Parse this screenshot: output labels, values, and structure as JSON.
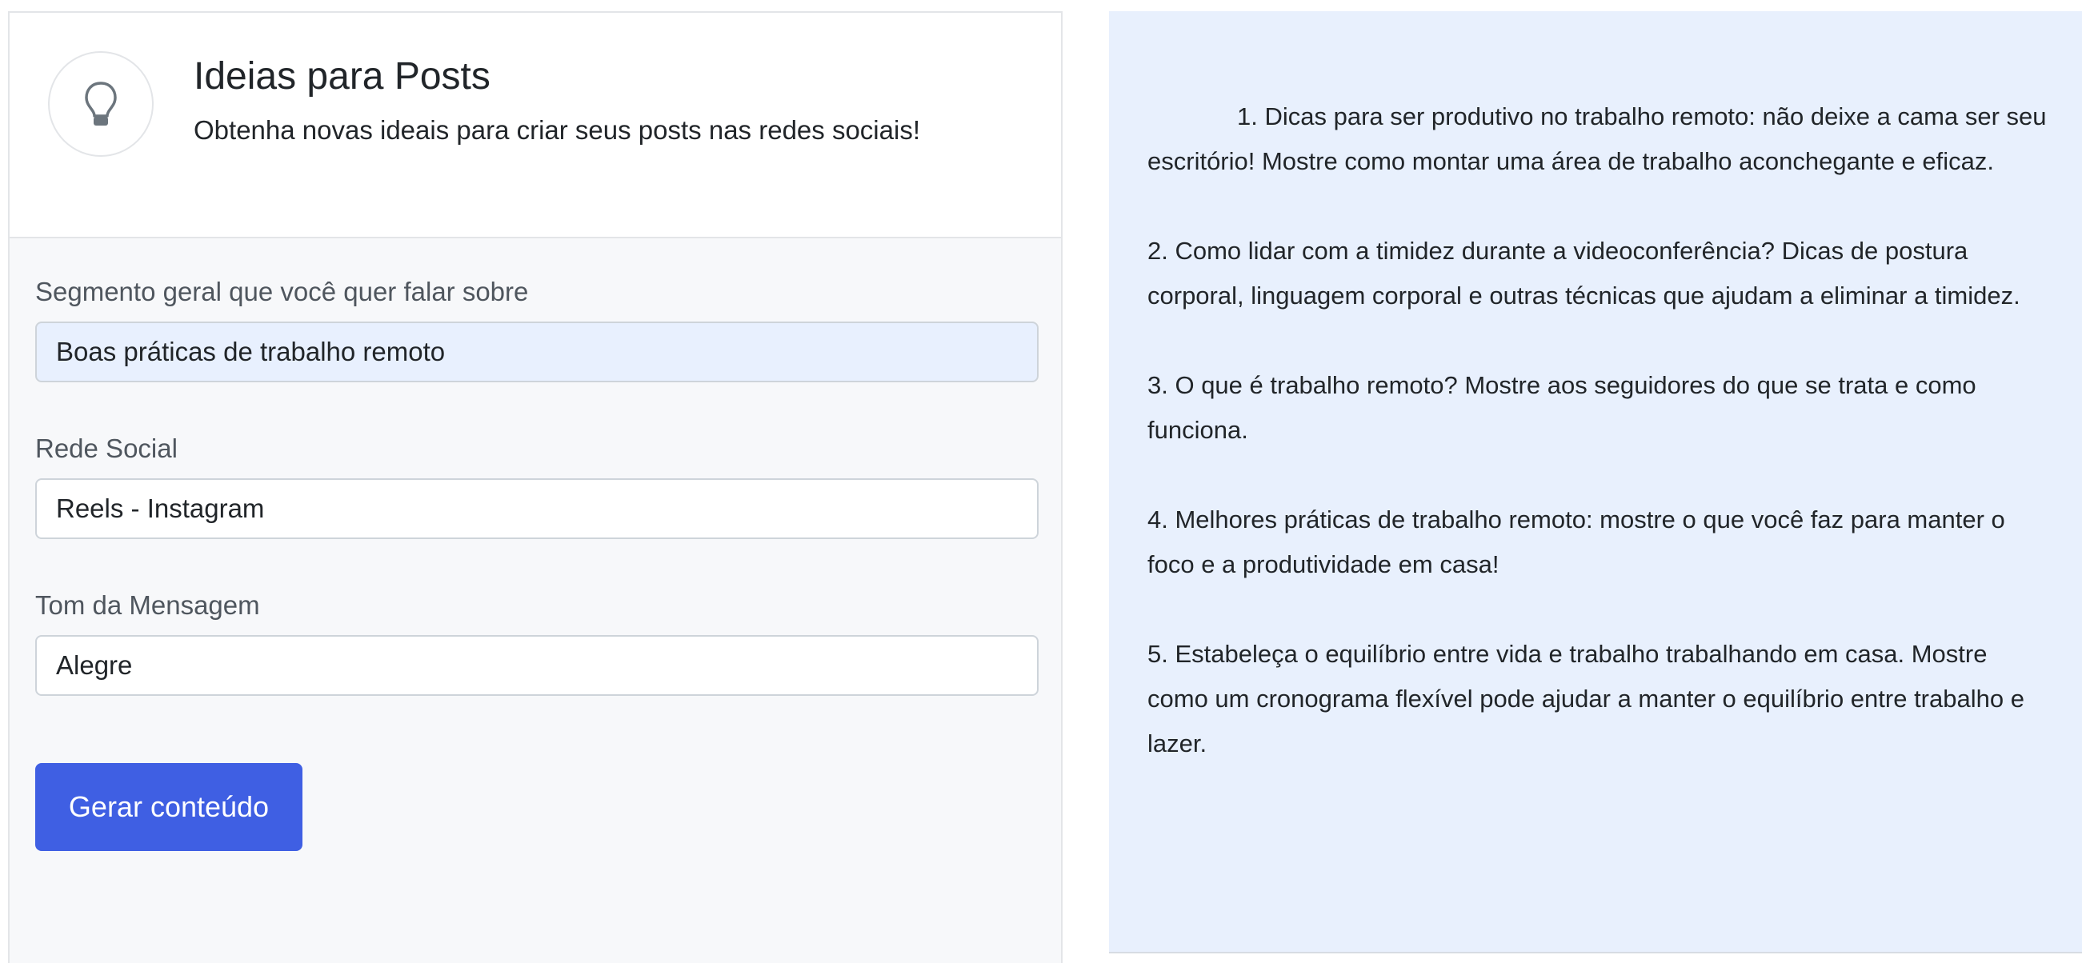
{
  "header": {
    "title": "Ideias para Posts",
    "subtitle": "Obtenha novas ideais para criar seus posts nas redes sociais!",
    "icon": "lightbulb-icon"
  },
  "form": {
    "segment": {
      "label": "Segmento geral que você quer falar sobre",
      "value": "Boas práticas de trabalho remoto"
    },
    "social": {
      "label": "Rede Social",
      "value": "Reels - Instagram"
    },
    "tone": {
      "label": "Tom da Mensagem",
      "value": "Alegre"
    },
    "submit_label": "Gerar conteúdo"
  },
  "output": {
    "ideas": [
      "1. Dicas para ser produtivo no trabalho remoto: não deixe a cama ser seu escritório! Mostre como montar uma área de trabalho aconchegante e eficaz.",
      "2. Como lidar com a timidez durante a videoconferência? Dicas de postura corporal, linguagem corporal e outras técnicas que ajudam a eliminar a timidez.",
      "3. O que é trabalho remoto? Mostre aos seguidores do que se trata e como funciona.",
      "4. Melhores práticas de trabalho remoto: mostre o que você faz para manter o foco e a produtividade em casa!",
      "5. Estabeleça o equilíbrio entre vida e trabalho trabalhando em casa. Mostre como um cronograma flexível pode ajudar a manter o equilíbrio entre trabalho e lazer."
    ]
  },
  "colors": {
    "primary_button": "#3f5fe3",
    "output_background": "#e8f0fd",
    "autofill_background": "#e8f0fe"
  }
}
